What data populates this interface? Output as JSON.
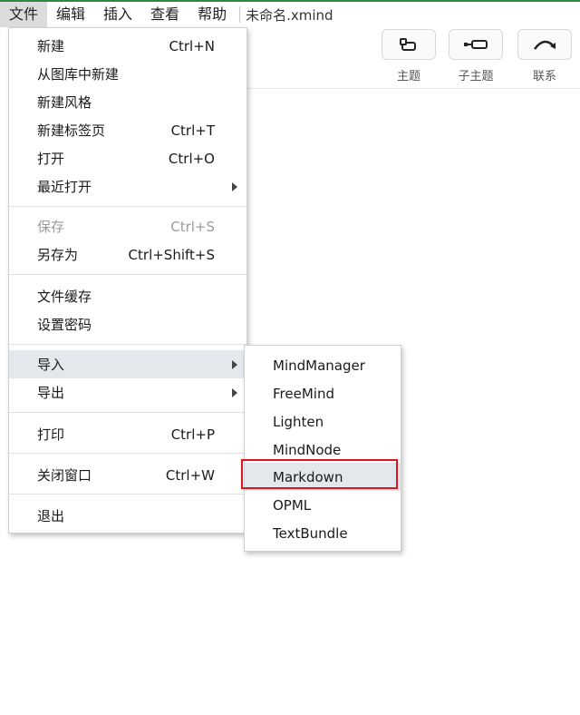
{
  "menubar": {
    "items": [
      "文件",
      "编辑",
      "插入",
      "查看",
      "帮助"
    ],
    "document_title": "未命名.xmind"
  },
  "toolbar": {
    "buttons": [
      {
        "label": "主题",
        "icon": "topic-icon"
      },
      {
        "label": "子主题",
        "icon": "subtopic-icon"
      },
      {
        "label": "联系",
        "icon": "relationship-icon"
      }
    ]
  },
  "file_menu": {
    "items": [
      {
        "label": "新建",
        "shortcut": "Ctrl+N"
      },
      {
        "label": "从图库中新建",
        "shortcut": ""
      },
      {
        "label": "新建风格",
        "shortcut": ""
      },
      {
        "label": "新建标签页",
        "shortcut": "Ctrl+T"
      },
      {
        "label": "打开",
        "shortcut": "Ctrl+O"
      },
      {
        "label": "最近打开",
        "shortcut": "",
        "submenu": true
      },
      {
        "label": "保存",
        "shortcut": "Ctrl+S",
        "disabled": true
      },
      {
        "label": "另存为",
        "shortcut": "Ctrl+Shift+S"
      },
      {
        "label": "文件缓存",
        "shortcut": ""
      },
      {
        "label": "设置密码",
        "shortcut": ""
      },
      {
        "label": "导入",
        "shortcut": "",
        "submenu": true,
        "highlighted": true
      },
      {
        "label": "导出",
        "shortcut": "",
        "submenu": true
      },
      {
        "label": "打印",
        "shortcut": "Ctrl+P"
      },
      {
        "label": "关闭窗口",
        "shortcut": "Ctrl+W"
      },
      {
        "label": "退出",
        "shortcut": ""
      }
    ]
  },
  "import_submenu": {
    "items": [
      "MindManager",
      "FreeMind",
      "Lighten",
      "MindNode",
      "Markdown",
      "OPML",
      "TextBundle"
    ],
    "highlighted": "Markdown"
  },
  "colors": {
    "highlight_outline": "#e0141e",
    "hover_background": "#e4e7ec",
    "top_strip": "#2c8c3c"
  }
}
